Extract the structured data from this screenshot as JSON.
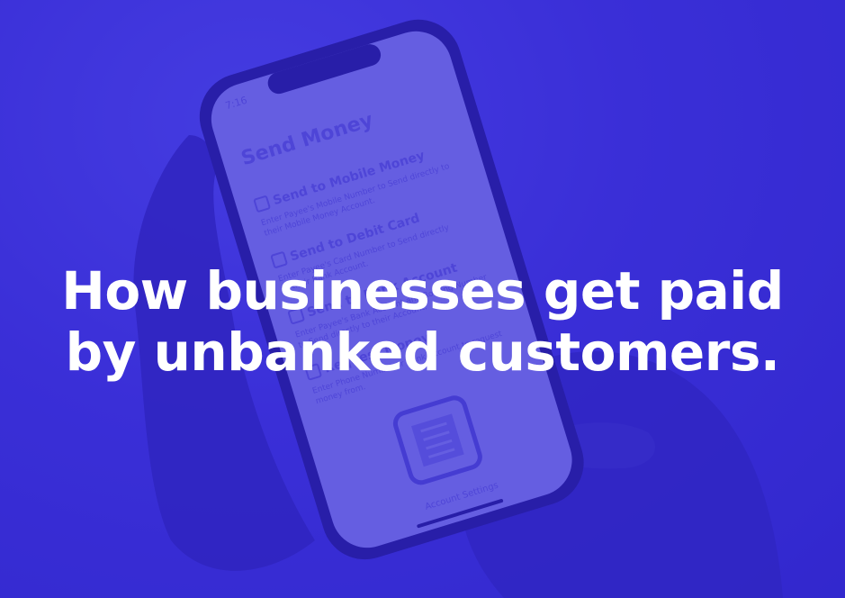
{
  "headline": {
    "line1": "How businesses get paid",
    "line2": "by unbanked customers."
  },
  "phone": {
    "status_time": "7:16",
    "screen_title": "Send Money",
    "options": [
      {
        "title": "Send to Mobile Money",
        "desc1": "Enter Payee's Mobile Number to Send directly to",
        "desc2": "their Mobile Money Account."
      },
      {
        "title": "Send to Debit Card",
        "desc1": "Enter Payee's Card Number to Send directly",
        "desc2": "to their Bank Account."
      },
      {
        "title": "Send to Bank Account",
        "desc1": "Enter Payee's Bank Account and Routing Number",
        "desc2": "to Send directly to their Account."
      },
      {
        "title": "Request Money",
        "desc1": "Enter Phone Number or Bank Account to request",
        "desc2": "money from."
      }
    ],
    "footer_link": "Account Settings"
  },
  "colors": {
    "overlay": "#3a2fd6",
    "headline": "#ffffff"
  }
}
